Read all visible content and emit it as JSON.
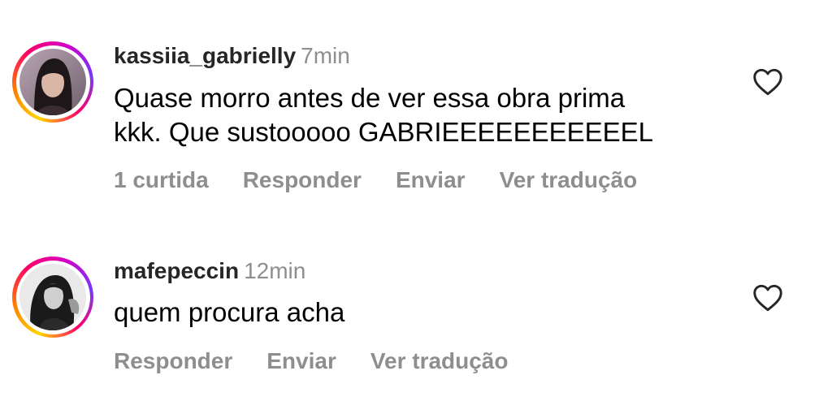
{
  "comments": [
    {
      "username": "kassiia_gabrielly",
      "time": "7min",
      "text_line1": "Quase morro antes de ver essa obra prima",
      "text_line2": "kkk. Que sustooooo GABRIEEEEEEEEEEEL",
      "likes": "1 curtida",
      "reply": "Responder",
      "send": "Enviar",
      "translate": "Ver tradução",
      "like_icon": "heart-outline-icon"
    },
    {
      "username": "mafepeccin",
      "time": "12min",
      "text_line1": "quem procura acha",
      "reply": "Responder",
      "send": "Enviar",
      "translate": "Ver tradução",
      "like_icon": "heart-outline-icon"
    }
  ],
  "colors": {
    "text": "#000000",
    "username": "#262626",
    "muted": "#8e8e8e",
    "story_ring": [
      "#ffd600",
      "#ff7a00",
      "#ff0069",
      "#d300c5",
      "#7638fa"
    ]
  }
}
